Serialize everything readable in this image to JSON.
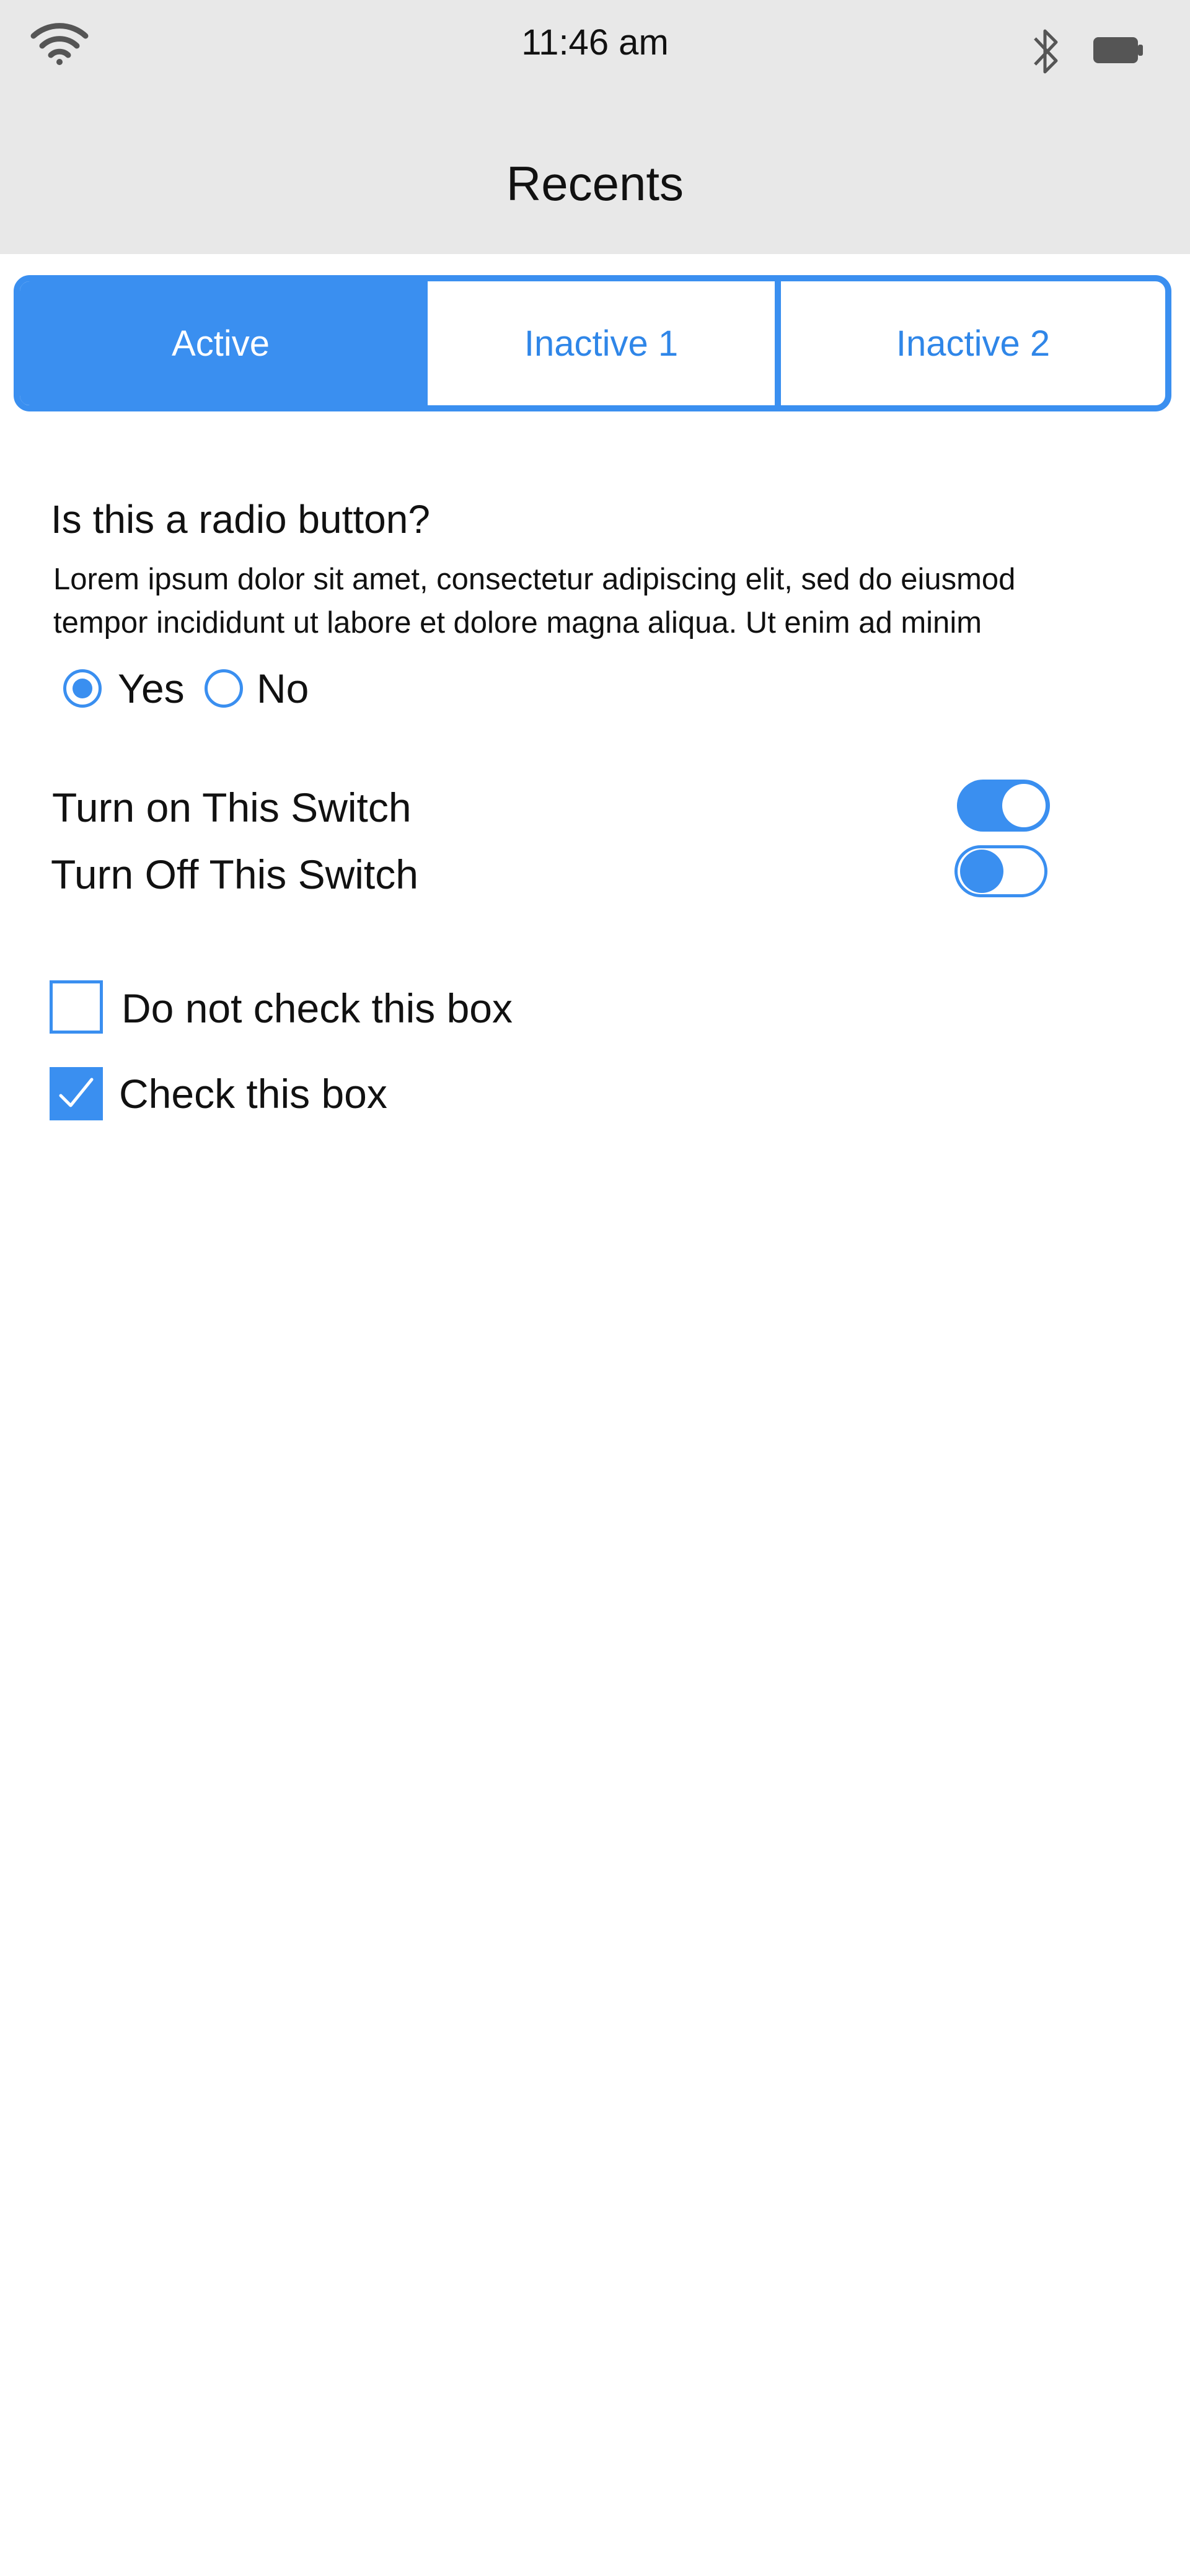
{
  "status_bar": {
    "time": "11:46 am",
    "icons": [
      "wifi-icon",
      "bluetooth-icon",
      "battery-icon"
    ]
  },
  "header": {
    "title": "Recents"
  },
  "tabs": [
    {
      "label": "Active",
      "active": true
    },
    {
      "label": "Inactive 1",
      "active": false
    },
    {
      "label": "Inactive 2",
      "active": false
    }
  ],
  "radio_section": {
    "question": "Is this a radio button?",
    "description": "Lorem ipsum dolor sit amet, consectetur adipiscing elit, sed do eiusmod tempor incididunt ut labore et dolore magna aliqua. Ut enim ad minim",
    "options": [
      {
        "label": "Yes",
        "selected": true
      },
      {
        "label": "No",
        "selected": false
      }
    ]
  },
  "switches": [
    {
      "label": "Turn on This Switch",
      "on": true
    },
    {
      "label": "Turn Off This Switch",
      "on": false
    }
  ],
  "checkboxes": [
    {
      "label": "Do not check this box",
      "checked": false
    },
    {
      "label": "Check this box",
      "checked": true
    }
  ],
  "colors": {
    "accent": "#3a8ff0",
    "header_bg": "#e8e8e8",
    "background": "#ffffff"
  }
}
